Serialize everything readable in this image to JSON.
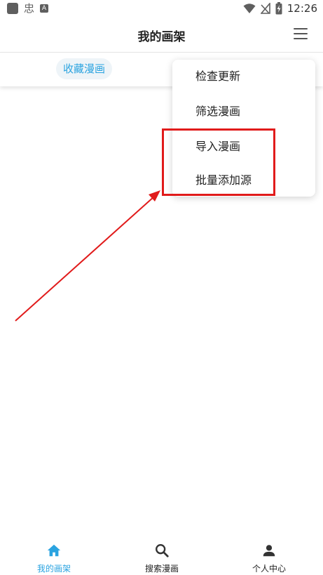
{
  "status_bar": {
    "time": "12:26",
    "left_icons": [
      "app-square-icon",
      "chinese-glyph-icon",
      "a-letter-icon"
    ],
    "left_glyph": "忠",
    "a_letter": "A",
    "right_icons": [
      "wifi-icon",
      "no-signal-icon",
      "battery-charging-icon"
    ]
  },
  "app_bar": {
    "title": "我的画架",
    "menu_icon": "hamburger-icon"
  },
  "tabs": {
    "active_label": "收藏漫画"
  },
  "popup_menu": {
    "items": [
      "检查更新",
      "筛选漫画",
      "导入漫画",
      "批量添加源"
    ]
  },
  "annotation": {
    "color": "#e11b1b"
  },
  "bottom_nav": {
    "items": [
      {
        "label": "我的画架",
        "icon": "home-icon",
        "active": true
      },
      {
        "label": "搜索漫画",
        "icon": "search-icon",
        "active": false
      },
      {
        "label": "个人中心",
        "icon": "person-icon",
        "active": false
      }
    ]
  },
  "colors": {
    "accent": "#2aa3e0",
    "annotation_red": "#e11b1b",
    "text": "#222222"
  }
}
